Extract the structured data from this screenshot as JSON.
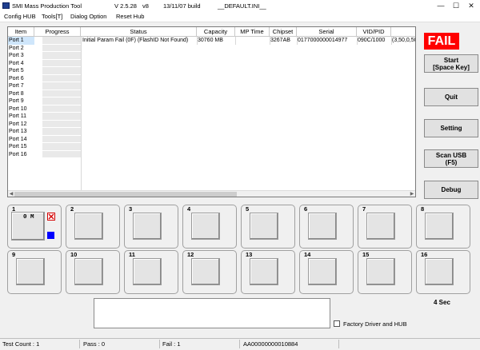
{
  "window": {
    "app_name": "SMI Mass Production Tool",
    "version": "V 2.5.28",
    "version_suffix": "v8",
    "build": "13/11/07 build",
    "ini": "__DEFAULT.INI__",
    "minimize_glyph": "—",
    "maximize_glyph": "☐",
    "close_glyph": "✕"
  },
  "menu": [
    "Config HUB",
    "Tools[T]",
    "Dialog Option",
    "Reset Hub"
  ],
  "table": {
    "headers": [
      "Item",
      "Progress",
      "Status",
      "Capacity",
      "MP Time",
      "Chipset",
      "Serial",
      "VID/PID",
      ""
    ],
    "ports": [
      "Port 1",
      "Port 2",
      "Port 3",
      "Port 4",
      "Port 5",
      "Port 6",
      "Port 7",
      "Port 8",
      "Port 9",
      "Port 10",
      "Port 11",
      "Port 12",
      "Port 13",
      "Port 14",
      "Port 15",
      "Port 16"
    ],
    "row1": {
      "status": "Initial Param Fail (0F) (FlashID Not Found)",
      "capacity": "30760 MB",
      "mp_time": "",
      "chipset": "3267AB",
      "serial": "0177000000014977",
      "vidpid": "090C/1000",
      "extra": "(3,50,0,50,0,"
    },
    "scroll_left": "◀",
    "scroll_right": "▶"
  },
  "result_badge": "FAIL",
  "buttons": {
    "start_line1": "Start",
    "start_line2": "[Space Key]",
    "quit": "Quit",
    "setting": "Setting",
    "scan_line1": "Scan USB",
    "scan_line2": "(F5)",
    "debug": "Debug"
  },
  "panels": [
    "1",
    "2",
    "3",
    "4",
    "5",
    "6",
    "7",
    "8",
    "9",
    "10",
    "11",
    "12",
    "13",
    "14",
    "15",
    "16"
  ],
  "panel1_text": "0 M",
  "elapsed": "4 Sec",
  "factory_driver_label": "Factory Driver and HUB",
  "status": {
    "test_count": "Test Count : 1",
    "pass": "Pass : 0",
    "fail": "Fail : 1",
    "serial": "AA00000000010884"
  },
  "colors": {
    "fail_red": "#ff0000",
    "selected_row": "#cfe6fb",
    "fail_indicator_blue": "#0000ff"
  }
}
